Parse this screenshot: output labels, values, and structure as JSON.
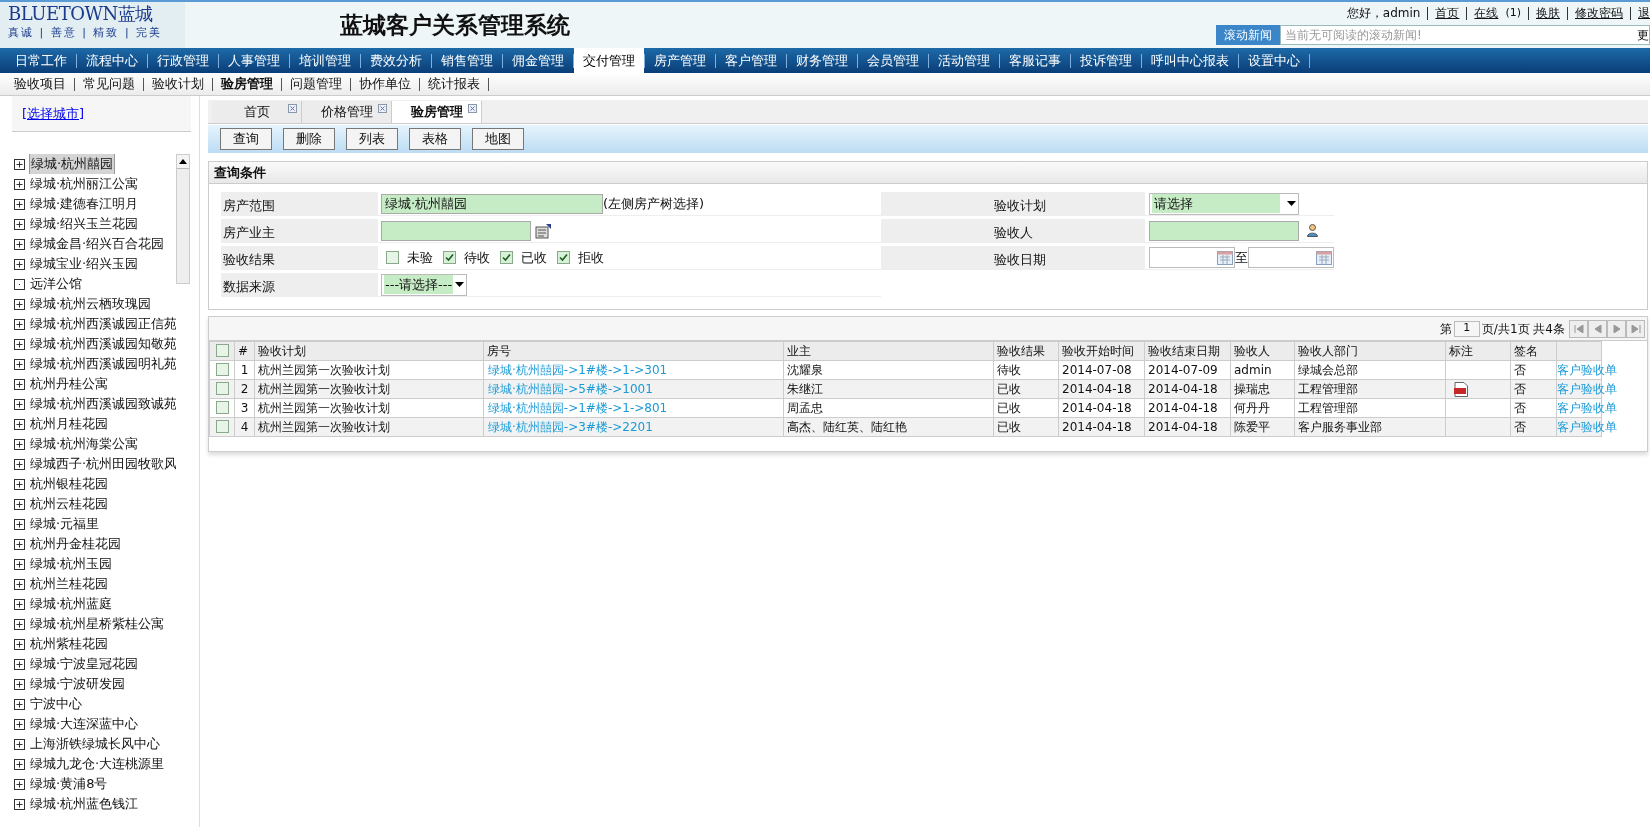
{
  "logo": {
    "brand": "BLUETOWN蓝城",
    "slogan": "真诚 | 善意 | 精致 | 完美"
  },
  "app_title": "蓝城客户关系管理系统",
  "user_bar": {
    "greeting": "您好，admin",
    "links": [
      "首页",
      "在线",
      "换肤",
      "修改密码",
      "退"
    ],
    "online_count": "(1)"
  },
  "news": {
    "label": "滚动新闻",
    "placeholder": "当前无可阅读的滚动新闻!",
    "more": "更"
  },
  "nav": [
    {
      "label": "日常工作",
      "selected": false
    },
    {
      "label": "流程中心",
      "selected": false
    },
    {
      "label": "行政管理",
      "selected": false
    },
    {
      "label": "人事管理",
      "selected": false
    },
    {
      "label": "培训管理",
      "selected": false
    },
    {
      "label": "费效分析",
      "selected": false
    },
    {
      "label": "销售管理",
      "selected": false
    },
    {
      "label": "佣金管理",
      "selected": false
    },
    {
      "label": "交付管理",
      "selected": true
    },
    {
      "label": "房产管理",
      "selected": false
    },
    {
      "label": "客户管理",
      "selected": false
    },
    {
      "label": "财务管理",
      "selected": false
    },
    {
      "label": "会员管理",
      "selected": false
    },
    {
      "label": "活动管理",
      "selected": false
    },
    {
      "label": "客服记事",
      "selected": false
    },
    {
      "label": "投诉管理",
      "selected": false
    },
    {
      "label": "呼叫中心报表",
      "selected": false
    },
    {
      "label": "设置中心",
      "selected": false
    }
  ],
  "subnav": [
    {
      "label": "验收项目",
      "selected": false
    },
    {
      "label": "常见问题",
      "selected": false
    },
    {
      "label": "验收计划",
      "selected": false
    },
    {
      "label": "验房管理",
      "selected": true
    },
    {
      "label": "问题管理",
      "selected": false
    },
    {
      "label": "协作单位",
      "selected": false
    },
    {
      "label": "统计报表",
      "selected": false
    }
  ],
  "sidebar": {
    "city_link": "[选择城市]",
    "tree": [
      {
        "label": "绿城·杭州囍园",
        "selected": true,
        "expandable": true
      },
      {
        "label": "绿城·杭州丽江公寓",
        "selected": false,
        "expandable": true
      },
      {
        "label": "绿城·建德春江明月",
        "selected": false,
        "expandable": true
      },
      {
        "label": "绿城·绍兴玉兰花园",
        "selected": false,
        "expandable": true
      },
      {
        "label": "绿城金昌·绍兴百合花园",
        "selected": false,
        "expandable": true
      },
      {
        "label": "绿城宝业·绍兴玉园",
        "selected": false,
        "expandable": true
      },
      {
        "label": "远洋公馆",
        "selected": false,
        "expandable": false
      },
      {
        "label": "绿城·杭州云栖玫瑰园",
        "selected": false,
        "expandable": true
      },
      {
        "label": "绿城·杭州西溪诚园正信苑",
        "selected": false,
        "expandable": true
      },
      {
        "label": "绿城·杭州西溪诚园知敬苑",
        "selected": false,
        "expandable": true
      },
      {
        "label": "绿城·杭州西溪诚园明礼苑",
        "selected": false,
        "expandable": true
      },
      {
        "label": "杭州丹桂公寓",
        "selected": false,
        "expandable": true
      },
      {
        "label": "绿城·杭州西溪诚园致诚苑",
        "selected": false,
        "expandable": true
      },
      {
        "label": "杭州月桂花园",
        "selected": false,
        "expandable": true
      },
      {
        "label": "绿城·杭州海棠公寓",
        "selected": false,
        "expandable": true
      },
      {
        "label": "绿城西子·杭州田园牧歌风",
        "selected": false,
        "expandable": true
      },
      {
        "label": "杭州银桂花园",
        "selected": false,
        "expandable": true
      },
      {
        "label": "杭州云桂花园",
        "selected": false,
        "expandable": true
      },
      {
        "label": "绿城·元福里",
        "selected": false,
        "expandable": true
      },
      {
        "label": "杭州丹金桂花园",
        "selected": false,
        "expandable": true
      },
      {
        "label": "绿城·杭州玉园",
        "selected": false,
        "expandable": true
      },
      {
        "label": "杭州兰桂花园",
        "selected": false,
        "expandable": true
      },
      {
        "label": "绿城·杭州蓝庭",
        "selected": false,
        "expandable": true
      },
      {
        "label": "绿城·杭州星桥紫桂公寓",
        "selected": false,
        "expandable": true
      },
      {
        "label": "杭州紫桂花园",
        "selected": false,
        "expandable": true
      },
      {
        "label": "绿城·宁波皇冠花园",
        "selected": false,
        "expandable": true
      },
      {
        "label": "绿城·宁波研发园",
        "selected": false,
        "expandable": true
      },
      {
        "label": "宁波中心",
        "selected": false,
        "expandable": true
      },
      {
        "label": "绿城·大连深蓝中心",
        "selected": false,
        "expandable": true
      },
      {
        "label": "上海浙铁绿城长风中心",
        "selected": false,
        "expandable": true
      },
      {
        "label": "绿城九龙仓·大连桃源里",
        "selected": false,
        "expandable": true
      },
      {
        "label": "绿城·黄浦8号",
        "selected": false,
        "expandable": true
      },
      {
        "label": "绿城·杭州蓝色钱江",
        "selected": false,
        "expandable": true
      }
    ]
  },
  "tabs": [
    {
      "label": "首页",
      "selected": false
    },
    {
      "label": "价格管理",
      "selected": false
    },
    {
      "label": "验房管理",
      "selected": true
    }
  ],
  "toolbar": [
    "查询",
    "删除",
    "列表",
    "表格",
    "地图"
  ],
  "query": {
    "title": "查询条件",
    "property_range": {
      "label": "房产范围",
      "value": "绿城·杭州囍园",
      "hint": "(左侧房产树选择)"
    },
    "owner": {
      "label": "房产业主"
    },
    "result": {
      "label": "验收结果",
      "options": [
        {
          "label": "未验",
          "checked": false
        },
        {
          "label": "待收",
          "checked": true
        },
        {
          "label": "已收",
          "checked": true
        },
        {
          "label": "拒收",
          "checked": true
        }
      ]
    },
    "source": {
      "label": "数据来源",
      "value": "---请选择---"
    },
    "plan": {
      "label": "验收计划",
      "value": "请选择"
    },
    "inspector": {
      "label": "验收人"
    },
    "date": {
      "label": "验收日期",
      "separator": "至"
    }
  },
  "pager": {
    "prefix": "第",
    "page": "1",
    "suffix": "页/共1页 共4条"
  },
  "table": {
    "all_checked": false,
    "columns": [
      "#",
      "验收计划",
      "房号",
      "业主",
      "验收结果",
      "验收开始时间",
      "验收结束日期",
      "验收人",
      "验收人部门",
      "标注",
      "签名"
    ],
    "rows": [
      {
        "no": "1",
        "plan": "杭州兰园第一次验收计划",
        "room": "绿城·杭州囍园->1#楼->1->301",
        "owner": "沈耀泉",
        "result": "待收",
        "start": "2014-07-08",
        "end": "2014-07-09",
        "inspector": "admin",
        "dept": "绿城会总部",
        "has_note": false,
        "signed": "否",
        "action": "客户验收单",
        "checked": false
      },
      {
        "no": "2",
        "plan": "杭州兰园第一次验收计划",
        "room": "绿城·杭州囍园->5#楼->1001",
        "owner": "朱继江",
        "result": "已收",
        "start": "2014-04-18",
        "end": "2014-04-18",
        "inspector": "操瑞忠",
        "dept": "工程管理部",
        "has_note": true,
        "signed": "否",
        "action": "客户验收单",
        "checked": false
      },
      {
        "no": "3",
        "plan": "杭州兰园第一次验收计划",
        "room": "绿城·杭州囍园->1#楼->1->801",
        "owner": "周孟忠",
        "result": "已收",
        "start": "2014-04-18",
        "end": "2014-04-18",
        "inspector": "何丹丹",
        "dept": "工程管理部",
        "has_note": false,
        "signed": "否",
        "action": "客户验收单",
        "checked": false
      },
      {
        "no": "4",
        "plan": "杭州兰园第一次验收计划",
        "room": "绿城·杭州囍园->3#楼->2201",
        "owner": "高杰、陆红英、陆红艳",
        "result": "已收",
        "start": "2014-04-18",
        "end": "2014-04-18",
        "inspector": "陈爱平",
        "dept": "客户服务事业部",
        "has_note": false,
        "signed": "否",
        "action": "客户验收单",
        "checked": false
      }
    ]
  }
}
